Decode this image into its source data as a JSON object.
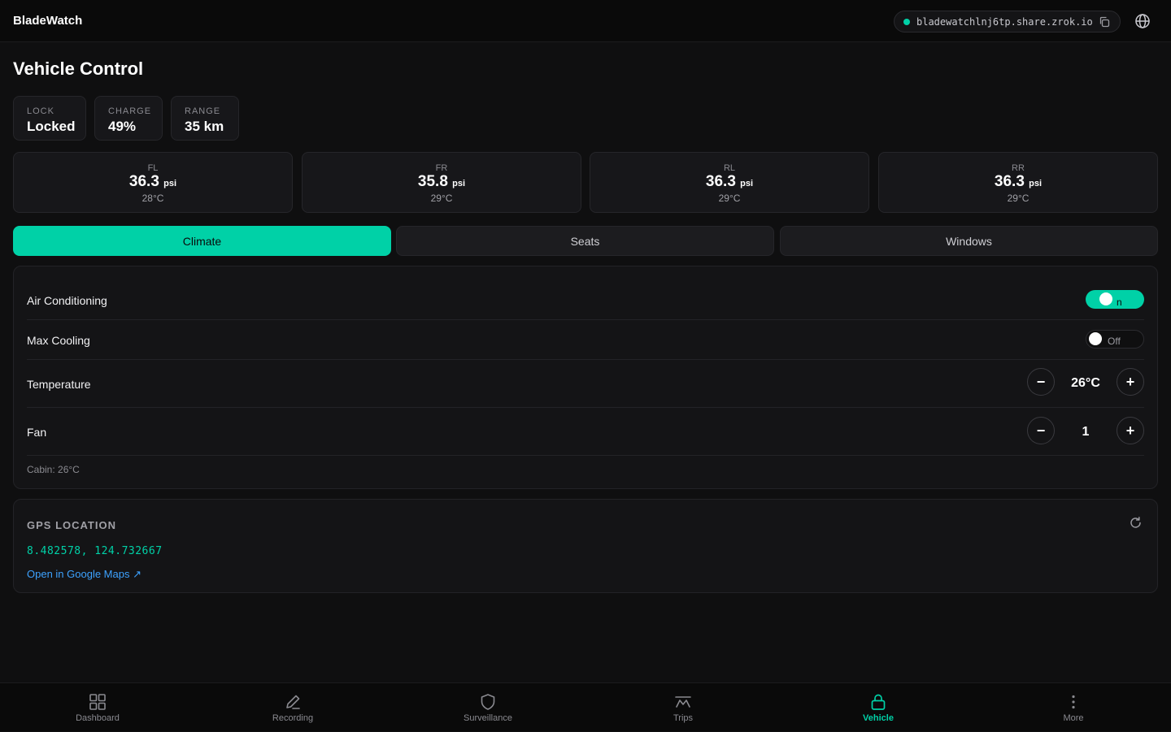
{
  "app": {
    "title": "BladeWatch"
  },
  "share": {
    "url": "bladewatchlnj6tp.share.zrok.io",
    "status_color": "#00d1a7"
  },
  "page": {
    "title": "Vehicle Control"
  },
  "stats": [
    {
      "label": "LOCK",
      "value": "Locked"
    },
    {
      "label": "CHARGE",
      "value": "49%"
    },
    {
      "label": "RANGE",
      "value": "35 km"
    }
  ],
  "tires": [
    {
      "position": "FL",
      "pressure": "36.3",
      "unit": "psi",
      "temp": "28°C"
    },
    {
      "position": "FR",
      "pressure": "35.8",
      "unit": "psi",
      "temp": "29°C"
    },
    {
      "position": "RL",
      "pressure": "36.3",
      "unit": "psi",
      "temp": "29°C"
    },
    {
      "position": "RR",
      "pressure": "36.3",
      "unit": "psi",
      "temp": "29°C"
    }
  ],
  "tabs": [
    {
      "label": "Climate",
      "active": true
    },
    {
      "label": "Seats",
      "active": false
    },
    {
      "label": "Windows",
      "active": false
    }
  ],
  "climate": {
    "air_conditioning": {
      "label": "Air Conditioning",
      "state": "On",
      "state_text": "n"
    },
    "max_cooling": {
      "label": "Max Cooling",
      "state": "Off",
      "state_text": "Off"
    },
    "temperature": {
      "label": "Temperature",
      "value": "26°C",
      "minus": "−",
      "plus": "+"
    },
    "fan": {
      "label": "Fan",
      "value": "1",
      "minus": "−",
      "plus": "+"
    },
    "cabin": "Cabin: 26°C"
  },
  "gps": {
    "title": "GPS LOCATION",
    "coords": "8.482578, 124.732667",
    "link": "Open in Google Maps ↗"
  },
  "nav": [
    {
      "label": "Dashboard",
      "icon": "grid-icon",
      "active": false
    },
    {
      "label": "Recording",
      "icon": "pencil-icon",
      "active": false
    },
    {
      "label": "Surveillance",
      "icon": "shield-icon",
      "active": false
    },
    {
      "label": "Trips",
      "icon": "route-icon",
      "active": false
    },
    {
      "label": "Vehicle",
      "icon": "lock-icon",
      "active": true
    },
    {
      "label": "More",
      "icon": "more-vertical-icon",
      "active": false
    }
  ],
  "colors": {
    "accent": "#00d1a7",
    "link": "#3da2ff",
    "background": "#0f0f10"
  }
}
